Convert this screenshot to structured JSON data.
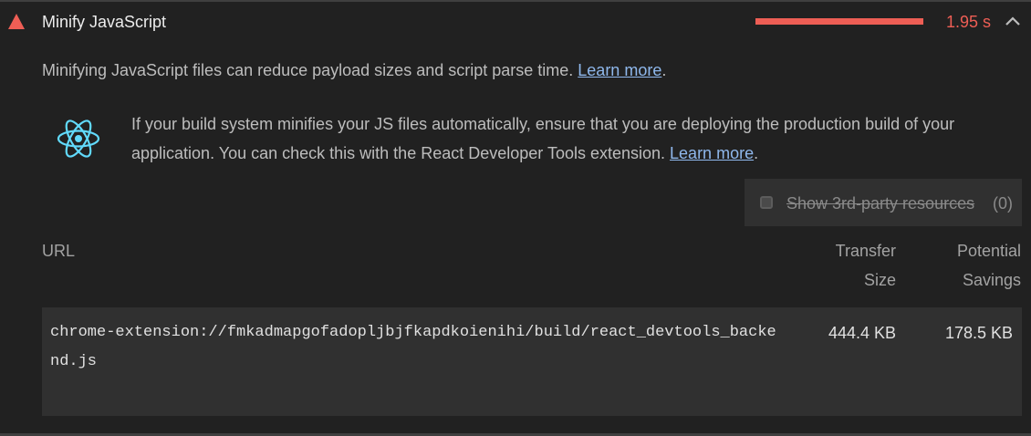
{
  "audit": {
    "status_icon": "warning-triangle-icon",
    "title": "Minify JavaScript",
    "timing": "1.95 s",
    "savings_fraction": 1.0,
    "collapse_icon": "chevron-up-icon",
    "description": "Minifying JavaScript files can reduce payload sizes and script parse time. ",
    "description_link": "Learn more",
    "description_end": ".",
    "colors": {
      "fail": "#ee5e55",
      "link": "#8fb8ec",
      "react": "#61dafb"
    }
  },
  "stack_pack": {
    "icon": "react-logo-icon",
    "text": "If your build system minifies your JS files automatically, ensure that you are deploying the production build of your application. You can check this with the React Developer Tools extension. ",
    "link": "Learn more",
    "end": "."
  },
  "filter": {
    "label": "Show 3rd-party resources",
    "count": "(0)",
    "checked": false
  },
  "table": {
    "headers": {
      "url": "URL",
      "transfer": "Transfer Size",
      "savings": "Potential Savings"
    },
    "rows": [
      {
        "url": "chrome-extension://fmkadmapgofadopljbjfkapdkoienihi/build/react_devtools_backend.js",
        "transfer": "444.4 KB",
        "savings": "178.5 KB"
      }
    ]
  }
}
